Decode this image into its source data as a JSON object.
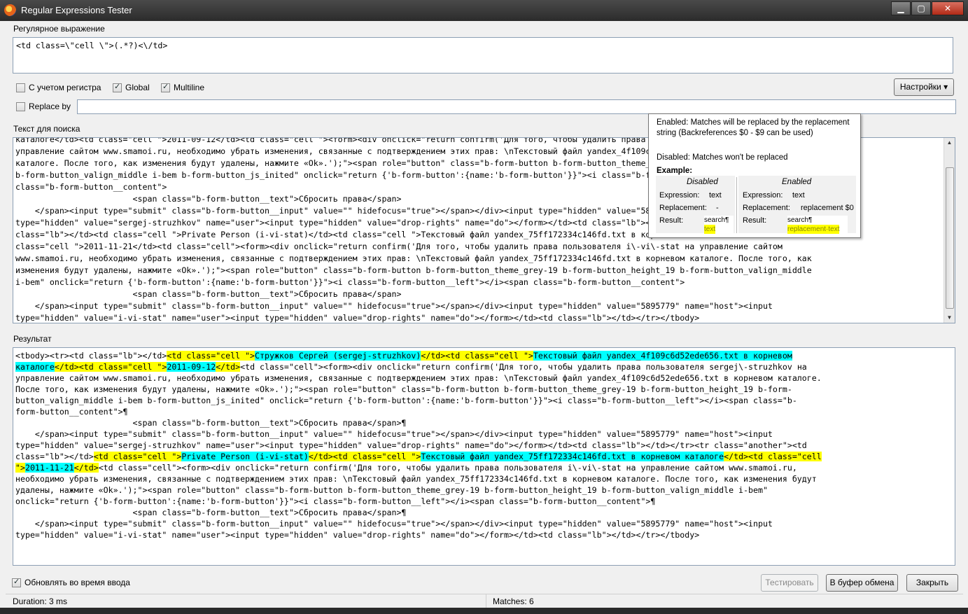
{
  "window": {
    "title": "Regular Expressions Tester"
  },
  "regex_section": {
    "label": "Регулярное выражение",
    "value": "<td class=\\\"cell \\\">(.*?)<\\/td>"
  },
  "options": {
    "case_sensitive": {
      "label": "С учетом регистра",
      "checked": false
    },
    "global": {
      "label": "Global",
      "checked": true
    },
    "multiline": {
      "label": "Multiline",
      "checked": true
    },
    "settings_button": "Настройки ▾"
  },
  "replace": {
    "label": "Replace by",
    "checked": false,
    "value": ""
  },
  "search_section": {
    "label": "Текст для поиска",
    "lines": [
      "каталоге</td><td class=\"cell \">2011-09-12</td><td class=\"cell \"><form><div onclick=\"return confirm('Для того, чтобы удалить права пользователя sergej\\-struzhkov на",
      "управление сайтом www.smamoi.ru, необходимо убрать изменения, связанные с подтверждением этих прав: \\nТекстовый файл yandex_4f109c6d52ede656.txt в корневом",
      "каталоге. После того, как изменения будут удалены, нажмите «Ok».');\"><span role=\"button\" class=\"b-form-button b-form-button_theme_grey-19 b-form-button_height_19",
      "b-form-button_valign_middle i-bem b-form-button_js_inited\" onclick=\"return {'b-form-button':{name:'b-form-button'}}\"><i class=\"b-form-button__left\"></i><span",
      "class=\"b-form-button__content\">",
      "                        <span class=\"b-form-button__text\">Сбросить права</span>",
      "    </span><input type=\"submit\" class=\"b-form-button__input\" value=\"\" hidefocus=\"true\"></span></div><input type=\"hidden\" value=\"5895779\" name=\"host\"><input",
      "type=\"hidden\" value=\"sergej-struzhkov\" name=\"user\"><input type=\"hidden\" value=\"drop-rights\" name=\"do\"></form></td><td class=\"lb\"></td></tr><tr class=\"another\"><td",
      "class=\"lb\"></td><td class=\"cell \">Private Person (i-vi-stat)</td><td class=\"cell \">Текстовый файл yandex_75ff172334c146fd.txt в корневом каталоге</td><td",
      "class=\"cell \">2011-11-21</td><td class=\"cell\"><form><div onclick=\"return confirm('Для того, чтобы удалить права пользователя i\\-vi\\-stat на управление сайтом",
      "www.smamoi.ru, необходимо убрать изменения, связанные с подтверждением этих прав: \\nТекстовый файл yandex_75ff172334c146fd.txt в корневом каталоге. После того, как",
      "изменения будут удалены, нажмите «Ok».');\"><span role=\"button\" class=\"b-form-button b-form-button_theme_grey-19 b-form-button_height_19 b-form-button_valign_middle",
      "i-bem\" onclick=\"return {'b-form-button':{name:'b-form-button'}}\"><i class=\"b-form-button__left\"></i><span class=\"b-form-button__content\">",
      "                        <span class=\"b-form-button__text\">Сбросить права</span>",
      "    </span><input type=\"submit\" class=\"b-form-button__input\" value=\"\" hidefocus=\"true\"></span></div><input type=\"hidden\" value=\"5895779\" name=\"host\"><input",
      "type=\"hidden\" value=\"i-vi-stat\" name=\"user\"><input type=\"hidden\" value=\"drop-rights\" name=\"do\"></form></td><td class=\"lb\"></td></tr></tbody>"
    ]
  },
  "result_section": {
    "label": "Результат",
    "lines": [
      [
        [
          "n",
          "<tbody><tr><td class=\"lb\"></td>"
        ],
        [
          "y",
          "<td class=\"cell \">"
        ],
        [
          "c",
          "Стружков Сергей (sergej-struzhkov)"
        ],
        [
          "y",
          "</td><td class=\"cell \">"
        ],
        [
          "c",
          "Текстовый файл yandex_4f109c6d52ede656.txt в корневом"
        ]
      ],
      [
        [
          "c",
          "каталоге"
        ],
        [
          "y",
          "</td><td class=\"cell \">"
        ],
        [
          "c",
          "2011-09-12"
        ],
        [
          "y",
          "</td>"
        ],
        [
          "n",
          "<td class=\"cell\"><form><div onclick=\"return confirm('Для того, чтобы удалить права пользователя sergej\\-struzhkov на"
        ]
      ],
      [
        [
          "n",
          "управление сайтом www.smamoi.ru, необходимо убрать изменения, связанные с подтверждением этих прав: \\nТекстовый файл yandex_4f109c6d52ede656.txt в корневом каталоге."
        ]
      ],
      [
        [
          "n",
          "После того, как изменения будут удалены, нажмите «Ok».');\"><span role=\"button\" class=\"b-form-button b-form-button_theme_grey-19 b-form-button_height_19 b-form-"
        ]
      ],
      [
        [
          "n",
          "button_valign_middle i-bem b-form-button_js_inited\" onclick=\"return {'b-form-button':{name:'b-form-button'}}\"><i class=\"b-form-button__left\"></i><span class=\"b-"
        ]
      ],
      [
        [
          "n",
          "form-button__content\">¶"
        ]
      ],
      [
        [
          "n",
          "                        <span class=\"b-form-button__text\">Сбросить права</span>¶"
        ]
      ],
      [
        [
          "n",
          "    </span><input type=\"submit\" class=\"b-form-button__input\" value=\"\" hidefocus=\"true\"></span></div><input type=\"hidden\" value=\"5895779\" name=\"host\"><input"
        ]
      ],
      [
        [
          "n",
          "type=\"hidden\" value=\"sergej-struzhkov\" name=\"user\"><input type=\"hidden\" value=\"drop-rights\" name=\"do\"></form></td><td class=\"lb\"></td></tr><tr class=\"another\"><td"
        ]
      ],
      [
        [
          "n",
          "class=\"lb\"></td>"
        ],
        [
          "y",
          "<td class=\"cell \">"
        ],
        [
          "c",
          "Private Person (i-vi-stat)"
        ],
        [
          "y",
          "</td><td class=\"cell \">"
        ],
        [
          "c",
          "Текстовый файл yandex_75ff172334c146fd.txt в корневом каталоге"
        ],
        [
          "y",
          "</td><td class=\"cell"
        ]
      ],
      [
        [
          "y",
          "\">"
        ],
        [
          "c",
          "2011-11-21"
        ],
        [
          "y",
          "</td>"
        ],
        [
          "n",
          "<td class=\"cell\"><form><div onclick=\"return confirm('Для того, чтобы удалить права пользователя i\\-vi\\-stat на управление сайтом www.smamoi.ru,"
        ]
      ],
      [
        [
          "n",
          "необходимо убрать изменения, связанные с подтверждением этих прав: \\nТекстовый файл yandex_75ff172334c146fd.txt в корневом каталоге. После того, как изменения будут"
        ]
      ],
      [
        [
          "n",
          "удалены, нажмите «Ok».');\"><span role=\"button\" class=\"b-form-button b-form-button_theme_grey-19 b-form-button_height_19 b-form-button_valign_middle i-bem\""
        ]
      ],
      [
        [
          "n",
          "onclick=\"return {'b-form-button':{name:'b-form-button'}}\"><i class=\"b-form-button__left\"></i><span class=\"b-form-button__content\">¶"
        ]
      ],
      [
        [
          "n",
          "                        <span class=\"b-form-button__text\">Сбросить права</span>¶"
        ]
      ],
      [
        [
          "n",
          "    </span><input type=\"submit\" class=\"b-form-button__input\" value=\"\" hidefocus=\"true\"></span></div><input type=\"hidden\" value=\"5895779\" name=\"host\"><input"
        ]
      ],
      [
        [
          "n",
          "type=\"hidden\" value=\"i-vi-stat\" name=\"user\"><input type=\"hidden\" value=\"drop-rights\" name=\"do\"></form></td><td class=\"lb\"></td></tr></tbody>"
        ]
      ]
    ]
  },
  "tooltip": {
    "enabled_text": "Enabled: Matches will be replaced by the replacement string (Backreferences $0 - $9 can be used)",
    "disabled_text": "Disabled: Matches won't be replaced",
    "example_label": "Example:",
    "disabled_col": {
      "title": "Disabled",
      "expression_label": "Expression:",
      "expression": "text",
      "replacement_label": "Replacement:",
      "replacement": "-",
      "result_label": "Result:",
      "result_line1": "search¶",
      "result_line2": "text"
    },
    "enabled_col": {
      "title": "Enabled",
      "expression_label": "Expression:",
      "expression": "text",
      "replacement_label": "Replacement:",
      "replacement": "replacement $0",
      "result_label": "Result:",
      "result_line1": "search¶",
      "result_line2": "replacement·text"
    }
  },
  "bottom": {
    "live_update": {
      "label": "Обновлять во время ввода",
      "checked": true
    },
    "test_button": "Тестировать",
    "copy_button": "В буфер обмена",
    "close_button": "Закрыть"
  },
  "status": {
    "duration": "Duration: 3 ms",
    "matches": "Matches: 6"
  },
  "colors": {
    "match_highlight": "#ffff00",
    "group_highlight": "#00ffff",
    "input_border": "#8c9fb4"
  }
}
